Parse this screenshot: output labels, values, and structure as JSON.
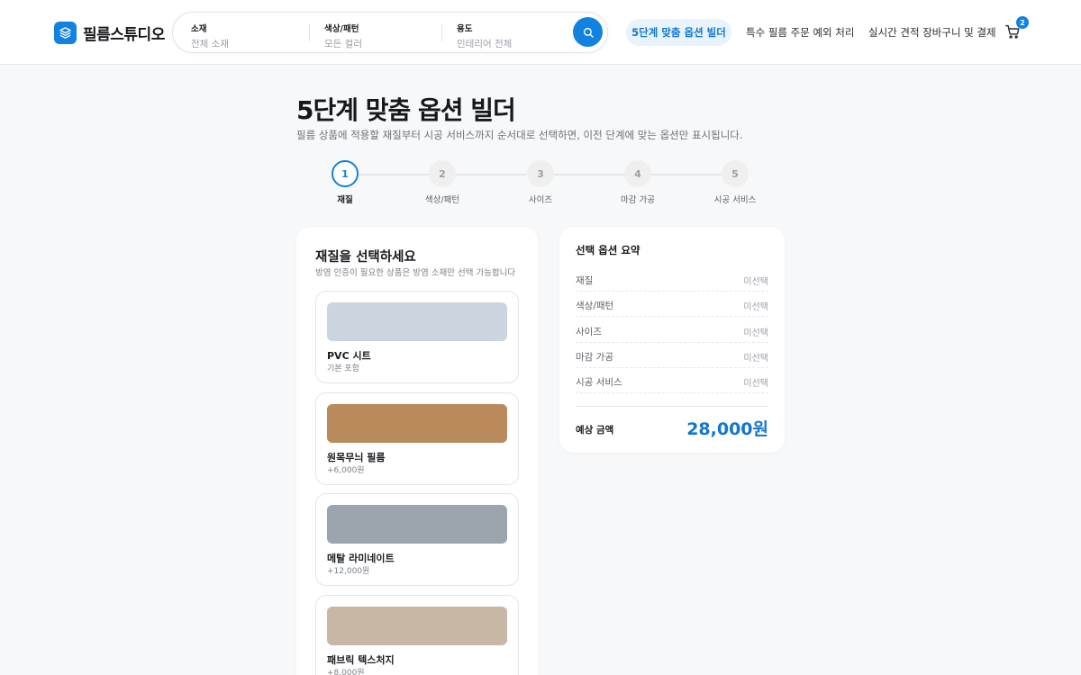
{
  "brand": {
    "name": "필름스튜디오",
    "accent_color": "#1282e0"
  },
  "search": {
    "segments": [
      {
        "label": "소재",
        "value": "전체 소재"
      },
      {
        "label": "색상/패턴",
        "value": "모든 컬러"
      },
      {
        "label": "용도",
        "value": "인테리어 전체"
      }
    ],
    "button_icon": "search-icon"
  },
  "nav": {
    "active": "5단계 맞춤 옵션 빌더",
    "links": [
      "특수 필름 주문 예외 처리",
      "실시간 견적 장바구니 및 결제"
    ],
    "cart_count": "2"
  },
  "page": {
    "title": "5단계 맞춤 옵션 빌더",
    "description": "필름 상품에 적용할 재질부터 시공 서비스까지 순서대로 선택하면, 이전 단계에 맞는 옵션만 표시됩니다."
  },
  "steps": [
    {
      "number": "1",
      "label": "재질",
      "active": true
    },
    {
      "number": "2",
      "label": "색상/패턴",
      "active": false
    },
    {
      "number": "3",
      "label": "사이즈",
      "active": false
    },
    {
      "number": "4",
      "label": "마감 가공",
      "active": false
    },
    {
      "number": "5",
      "label": "시공 서비스",
      "active": false
    }
  ],
  "material_panel": {
    "title": "재질을 선택하세요",
    "description": "방염 인증이 필요한 상품은 방염 소재만 선택 가능합니다",
    "options": [
      {
        "name": "PVC 시트",
        "price": "기본 포함",
        "color": "#cbd5df"
      },
      {
        "name": "원목무늬 필름",
        "price": "+6,000원",
        "color": "#b98a5c"
      },
      {
        "name": "메탈 라미네이트",
        "price": "+12,000원",
        "color": "#9ca5ae"
      },
      {
        "name": "패브릭 텍스처지",
        "price": "+8,000원",
        "color": "#c8b7a4"
      }
    ]
  },
  "summary": {
    "title": "선택 옵션 요약",
    "rows": [
      {
        "key": "재질",
        "value": "미선택"
      },
      {
        "key": "색상/패턴",
        "value": "미선택"
      },
      {
        "key": "사이즈",
        "value": "미선택"
      },
      {
        "key": "마감 가공",
        "value": "미선택"
      },
      {
        "key": "시공 서비스",
        "value": "미선택"
      }
    ],
    "total_label": "예상 금액",
    "total_value": "28,000원"
  }
}
